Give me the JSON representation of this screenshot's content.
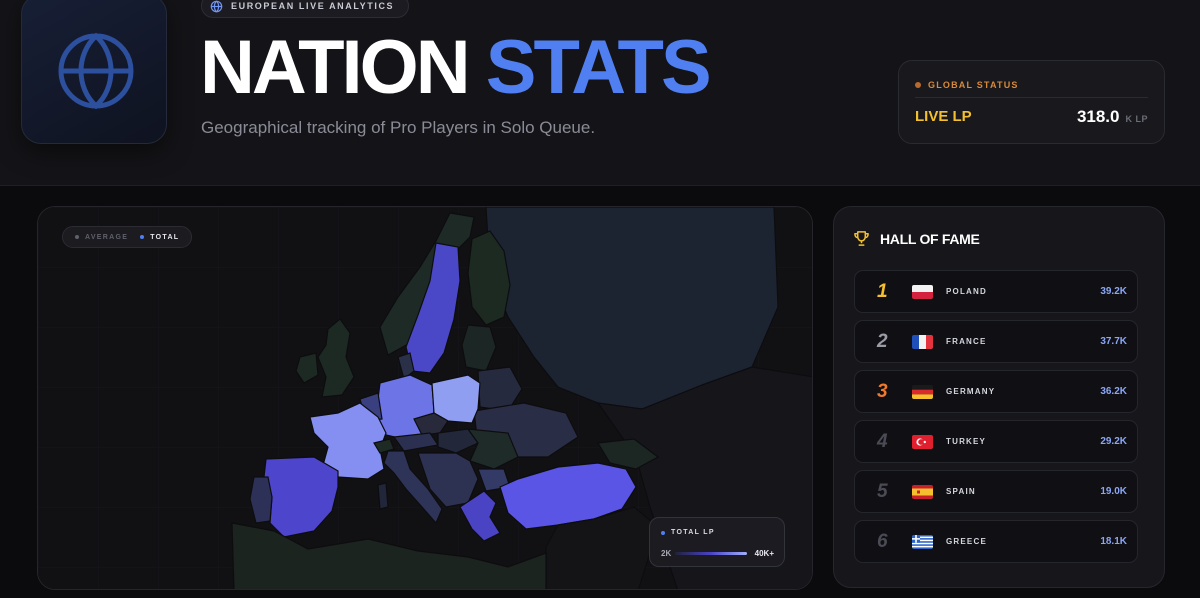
{
  "header": {
    "badge": "EUROPEAN LIVE ANALYTICS",
    "title_word1": "NATION",
    "title_word2": "STATS",
    "subtitle": "Geographical tracking of Pro Players in Solo Queue."
  },
  "status": {
    "label": "GLOBAL STATUS",
    "metric": "LIVE LP",
    "value": "318.0",
    "unit": "K LP"
  },
  "map": {
    "toggle": [
      {
        "label": "AVERAGE",
        "active": false
      },
      {
        "label": "TOTAL",
        "active": true
      }
    ],
    "legend": {
      "title": "TOTAL LP",
      "min": "2K",
      "max": "40K+"
    }
  },
  "hall_of_fame": {
    "title": "HALL OF FAME",
    "entries": [
      {
        "rank": "1",
        "country": "POLAND",
        "score": "39.2K",
        "rank_color": "#f5c02e"
      },
      {
        "rank": "2",
        "country": "FRANCE",
        "score": "37.7K",
        "rank_color": "#9a9ba6"
      },
      {
        "rank": "3",
        "country": "GERMANY",
        "score": "36.2K",
        "rank_color": "#f07a2a"
      },
      {
        "rank": "4",
        "country": "TURKEY",
        "score": "29.2K",
        "rank_color": "#4a4b55"
      },
      {
        "rank": "5",
        "country": "SPAIN",
        "score": "19.0K",
        "rank_color": "#4a4b55"
      },
      {
        "rank": "6",
        "country": "GREECE",
        "score": "18.1K",
        "rank_color": "#4a4b55"
      }
    ]
  },
  "colors": {
    "accent": "#4f7ff0",
    "gold": "#f5c02e",
    "orange": "#d78a3c"
  },
  "icons": [
    "globe-icon",
    "trophy-icon"
  ]
}
